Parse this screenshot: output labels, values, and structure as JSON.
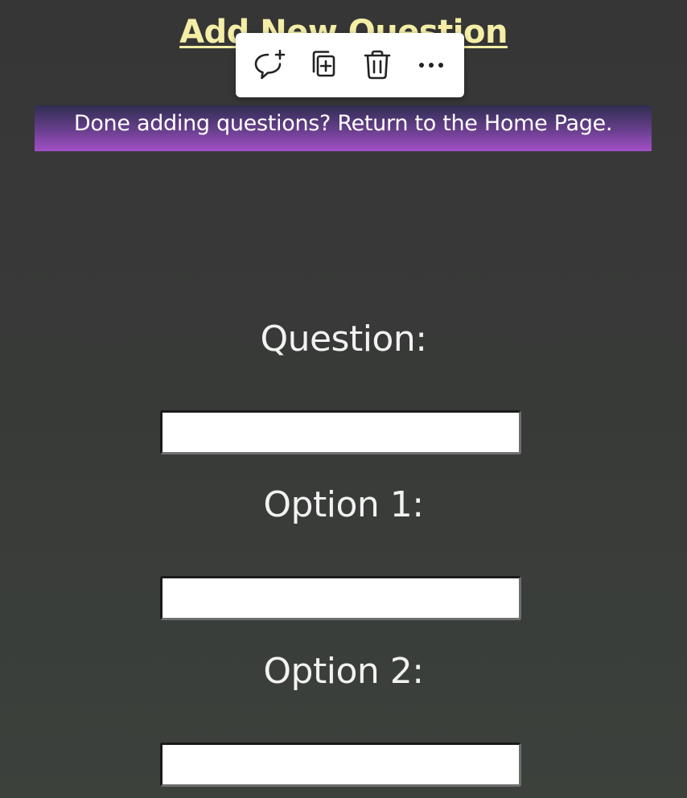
{
  "page": {
    "title": "Add New Question"
  },
  "toolbar": {
    "items": [
      {
        "icon": "comment-add-icon",
        "label": "New comment"
      },
      {
        "icon": "copy-icon",
        "label": "Duplicate"
      },
      {
        "icon": "trash-icon",
        "label": "Delete"
      },
      {
        "icon": "more-icon",
        "label": "More options"
      }
    ]
  },
  "banner": {
    "text": "Done adding questions? Return to the Home Page."
  },
  "form": {
    "question_label": "Question:",
    "question_value": "",
    "option1_label": "Option 1:",
    "option1_value": "",
    "option2_label": "Option 2:",
    "option2_value": ""
  },
  "colors": {
    "title": "#f4eea6",
    "banner_top": "#2f2e52",
    "banner_bottom": "#a250c8",
    "background": "#383a38"
  }
}
